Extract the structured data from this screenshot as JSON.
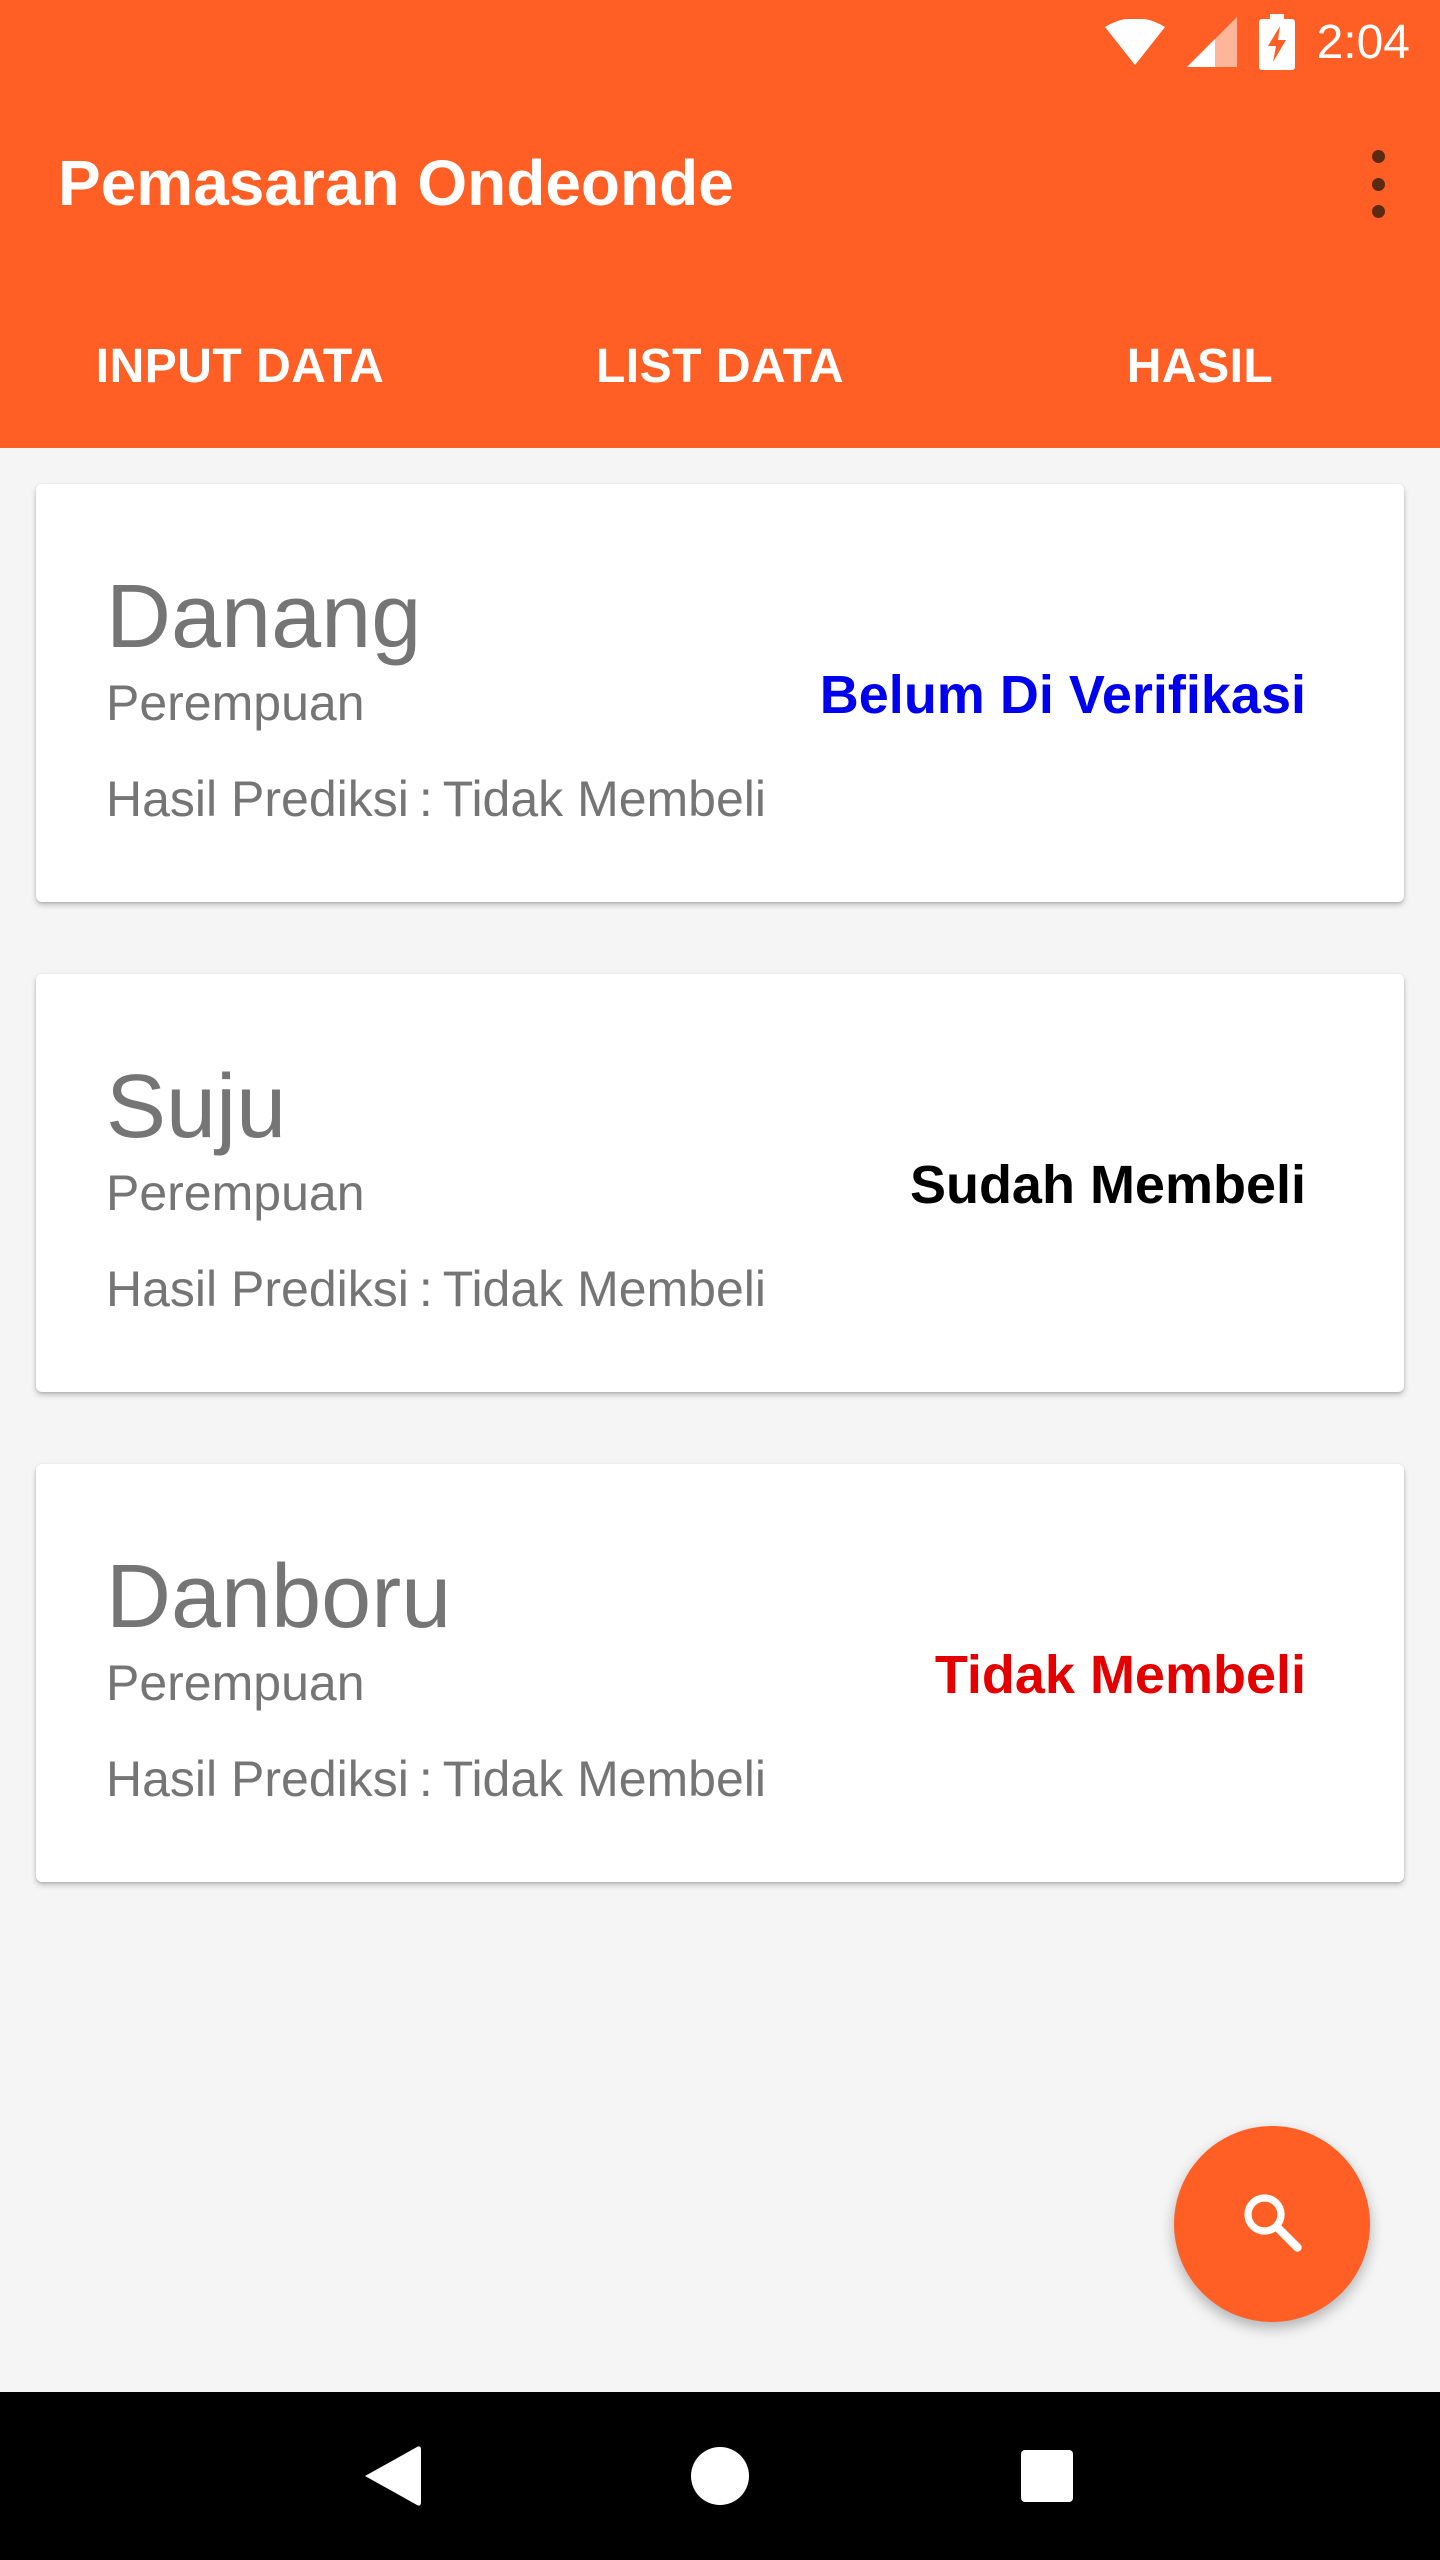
{
  "status_bar": {
    "time": "2:04",
    "icons": [
      "wifi-icon",
      "signal-icon",
      "battery-charging-icon"
    ]
  },
  "app_bar": {
    "title": "Pemasaran Ondeonde",
    "menu_icon": "overflow-menu-icon"
  },
  "tabs": [
    {
      "label": "INPUT DATA"
    },
    {
      "label": "LIST DATA"
    },
    {
      "label": "HASIL"
    }
  ],
  "cards": [
    {
      "name": "Danang",
      "gender": "Perempuan",
      "prediction_label": "Hasil Prediksi",
      "prediction_sep": ":",
      "prediction_value": "Tidak Membeli",
      "status": "Belum Di Verifikasi",
      "status_color": "#0000ee"
    },
    {
      "name": "Suju",
      "gender": "Perempuan",
      "prediction_label": "Hasil Prediksi",
      "prediction_sep": ":",
      "prediction_value": "Tidak Membeli",
      "status": "Sudah Membeli",
      "status_color": "#000000"
    },
    {
      "name": "Danboru",
      "gender": "Perempuan",
      "prediction_label": "Hasil Prediksi",
      "prediction_sep": ":",
      "prediction_value": "Tidak Membeli",
      "status": "Tidak Membeli",
      "status_color": "#e50000"
    }
  ],
  "fab": {
    "icon": "search-icon"
  },
  "nav_bar": {
    "icons": [
      "back-icon",
      "home-icon",
      "recents-icon"
    ]
  },
  "colors": {
    "primary": "#ff5f24",
    "background": "#f5f5f5",
    "card": "#ffffff",
    "secondary_text": "#757575"
  }
}
